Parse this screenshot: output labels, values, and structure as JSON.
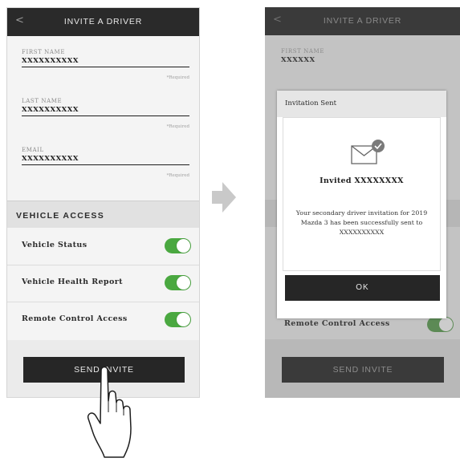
{
  "left_screen": {
    "back_glyph": "<",
    "title": "INVITE A DRIVER",
    "fields": [
      {
        "label": "FIRST NAME",
        "value": "XXXXXXXXXX",
        "required": "*Required"
      },
      {
        "label": "LAST NAME",
        "value": "XXXXXXXXXX",
        "required": "*Required"
      },
      {
        "label": "EMAIL",
        "value": "XXXXXXXXXX",
        "required": "*Required"
      }
    ],
    "section_header": "VEHICLE ACCESS",
    "access_items": [
      {
        "label": "Vehicle Status",
        "enabled": true
      },
      {
        "label": "Vehicle Health Report",
        "enabled": true
      },
      {
        "label": "Remote Control Access",
        "enabled": true
      }
    ],
    "send_button": "SEND INVITE"
  },
  "right_screen": {
    "back_glyph": "<",
    "title": "INVITE A DRIVER",
    "first_name_label": "FIRST NAME",
    "first_name_value": "XXXXXX",
    "remote_label": "Remote Control Access",
    "send_button": "SEND INVITE",
    "dialog": {
      "title": "Invitation Sent",
      "icon": "envelope-check-icon",
      "heading": "Invited XXXXXXXX",
      "message": "Your secondary driver invitation for 2019 Mazda 3 has been successfully sent to",
      "email": "XXXXXXXXXX",
      "ok_button": "OK"
    }
  },
  "colors": {
    "toggle_on": "#4aa840",
    "topbar": "#2a2a2a",
    "button": "#262626"
  }
}
